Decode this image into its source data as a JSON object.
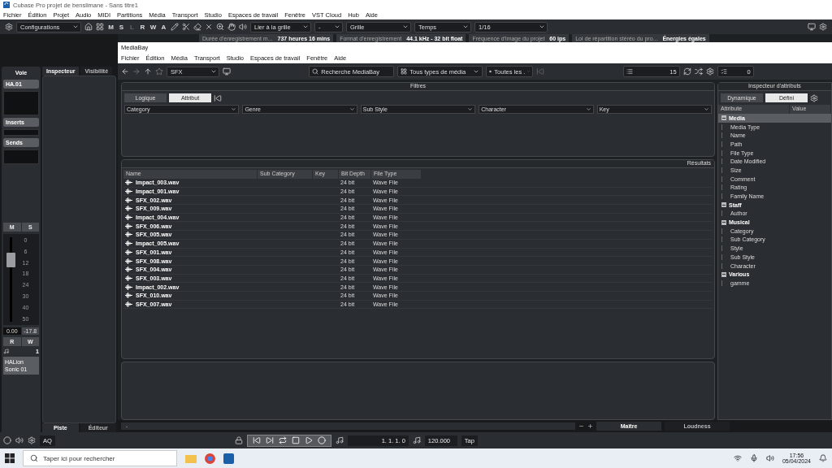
{
  "app_title": "Cubase Pro projet de benslimane - Sans titre1",
  "menu": [
    "Fichier",
    "Édition",
    "Projet",
    "Audio",
    "MIDI",
    "Partitions",
    "Média",
    "Transport",
    "Studio",
    "Espaces de travail",
    "Fenêtre",
    "VST Cloud",
    "Hub",
    "Aide"
  ],
  "toolbar": {
    "configurations": "Configurations",
    "modes": [
      "M",
      "S",
      "L",
      "R",
      "W",
      "A"
    ],
    "snap": "Lier à la grille",
    "snap_type": "-",
    "grid": "Grille",
    "grid_type": "Temps",
    "quantize": "1/16"
  },
  "project_info": [
    {
      "label": "Durée d'enregistrement m...",
      "value": "737 heures 16 mins"
    },
    {
      "label": "Format d'enregistrement",
      "value": "44.1 kHz - 32 bit float"
    },
    {
      "label": "Fréquence d'image du projet",
      "value": "60 ips"
    },
    {
      "label": "Loi de répartition stéréo du pro...",
      "value": "Énergies égales"
    }
  ],
  "left_zone": {
    "channel_tab": "Voie",
    "channel_name": "HA.01",
    "inserts": "Inserts",
    "sends": "Sends",
    "mute": "M",
    "solo": "S",
    "fader_scale": [
      "0",
      "6",
      "12",
      "18",
      "24",
      "30",
      "40",
      "50"
    ],
    "fader": {
      "level": 0.78
    },
    "volume": "0.00",
    "peak": "-17.8",
    "read": "R",
    "write": "W",
    "track_number": "1",
    "instrument": "HALion Sonic 01",
    "inspector_tabs": [
      {
        "label": "Inspecteur",
        "selected": true
      },
      {
        "label": "Visibilité",
        "selected": false
      }
    ],
    "bottom_tabs": [
      {
        "label": "Piste",
        "selected": true
      },
      {
        "label": "Éditeur",
        "selected": false
      }
    ]
  },
  "mediabay": {
    "title": "MediaBay",
    "menu": [
      "Fichier",
      "Édition",
      "Média",
      "Transport",
      "Studio",
      "Espaces de travail",
      "Fenêtre",
      "Aide"
    ],
    "location": "SFX",
    "search_placeholder": "Recherche MediaBay",
    "media_type": "Tous types de média",
    "rating_filter": "Toutes les .",
    "result_count": "15",
    "selection_count": "0",
    "filters": {
      "title": "Filtres",
      "modes": [
        {
          "label": "Logique",
          "selected": false
        },
        {
          "label": "Attribut",
          "selected": true
        }
      ],
      "columns": [
        "Category",
        "Genre",
        "Sub Style",
        "Character",
        "Key"
      ]
    },
    "results": {
      "title": "Résultats",
      "columns": [
        "Name",
        "Sub Category",
        "Key",
        "Bit Depth",
        "File Type"
      ],
      "rows": [
        {
          "name": "Impact_003.wav",
          "bit_depth": "24 bit",
          "file_type": "Wave File"
        },
        {
          "name": "Impact_001.wav",
          "bit_depth": "24 bit",
          "file_type": "Wave File"
        },
        {
          "name": "SFX_002.wav",
          "bit_depth": "24 bit",
          "file_type": "Wave File"
        },
        {
          "name": "SFX_009.wav",
          "bit_depth": "24 bit",
          "file_type": "Wave File"
        },
        {
          "name": "Impact_004.wav",
          "bit_depth": "24 bit",
          "file_type": "Wave File"
        },
        {
          "name": "SFX_006.wav",
          "bit_depth": "24 bit",
          "file_type": "Wave File"
        },
        {
          "name": "SFX_005.wav",
          "bit_depth": "24 bit",
          "file_type": "Wave File"
        },
        {
          "name": "Impact_005.wav",
          "bit_depth": "24 bit",
          "file_type": "Wave File"
        },
        {
          "name": "SFX_001.wav",
          "bit_depth": "24 bit",
          "file_type": "Wave File"
        },
        {
          "name": "SFX_008.wav",
          "bit_depth": "24 bit",
          "file_type": "Wave File"
        },
        {
          "name": "SFX_004.wav",
          "bit_depth": "24 bit",
          "file_type": "Wave File"
        },
        {
          "name": "SFX_003.wav",
          "bit_depth": "24 bit",
          "file_type": "Wave File"
        },
        {
          "name": "Impact_002.wav",
          "bit_depth": "24 bit",
          "file_type": "Wave File"
        },
        {
          "name": "SFX_010.wav",
          "bit_depth": "24 bit",
          "file_type": "Wave File"
        },
        {
          "name": "SFX_007.wav",
          "bit_depth": "24 bit",
          "file_type": "Wave File"
        }
      ]
    },
    "inspector": {
      "title": "Inspecteur d'attributs",
      "modes": [
        {
          "label": "Dynamique",
          "selected": false
        },
        {
          "label": "Défini",
          "selected": true
        }
      ],
      "columns": [
        "Attribute",
        "Value"
      ],
      "groups": [
        {
          "label": "Media",
          "expanded": true,
          "selected": true,
          "children": [
            {
              "label": "Media Type"
            },
            {
              "label": "Name"
            },
            {
              "label": "Path"
            },
            {
              "label": "File Type"
            },
            {
              "label": "Date Modified"
            },
            {
              "label": "Size"
            },
            {
              "label": "Comment"
            },
            {
              "label": "Rating"
            },
            {
              "label": "Family Name"
            }
          ]
        },
        {
          "label": "Staff",
          "expanded": true,
          "selected": false,
          "children": [
            {
              "label": "Author"
            }
          ]
        },
        {
          "label": "Musical",
          "expanded": true,
          "selected": false,
          "children": [
            {
              "label": "Category"
            },
            {
              "label": "Sub Category"
            },
            {
              "label": "Style"
            },
            {
              "label": "Sub Style"
            },
            {
              "label": "Character"
            }
          ]
        },
        {
          "label": "Various",
          "expanded": true,
          "selected": false,
          "children": [
            {
              "label": "gamme"
            }
          ]
        }
      ]
    }
  },
  "bottom_scroll": "-",
  "bottom_tabs": [
    {
      "label": "Maître",
      "selected": true
    },
    {
      "label": "Loudness",
      "selected": false
    }
  ],
  "transport": {
    "aq": "AQ",
    "position": "1. 1. 1. 0",
    "tempo": "120.000",
    "tap": "Tap"
  },
  "taskbar": {
    "search_placeholder": "Taper ici pour rechercher",
    "time": "17:56",
    "date": "05/04/2024"
  }
}
